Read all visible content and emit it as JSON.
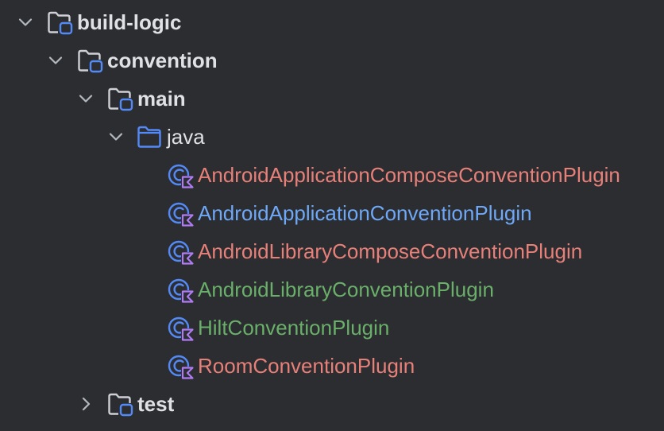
{
  "tree": {
    "build_logic": {
      "label": "build-logic",
      "expanded": true,
      "icon": "module-folder-icon"
    },
    "convention": {
      "label": "convention",
      "expanded": true,
      "icon": "module-folder-icon"
    },
    "main": {
      "label": "main",
      "expanded": true,
      "icon": "module-folder-icon"
    },
    "java": {
      "label": "java",
      "expanded": true,
      "icon": "source-folder-icon"
    },
    "files": [
      {
        "label": "AndroidApplicationComposeConventionPlugin",
        "color": "#e8807a",
        "icon": "kotlin-class-icon"
      },
      {
        "label": "AndroidApplicationConventionPlugin",
        "color": "#6fa8f7",
        "icon": "kotlin-class-icon"
      },
      {
        "label": "AndroidLibraryComposeConventionPlugin",
        "color": "#e8807a",
        "icon": "kotlin-class-icon"
      },
      {
        "label": "AndroidLibraryConventionPlugin",
        "color": "#6aaf6a",
        "icon": "kotlin-class-icon"
      },
      {
        "label": "HiltConventionPlugin",
        "color": "#6aaf6a",
        "icon": "kotlin-class-icon"
      },
      {
        "label": "RoomConventionPlugin",
        "color": "#e8807a",
        "icon": "kotlin-class-icon"
      }
    ],
    "test": {
      "label": "test",
      "expanded": false,
      "icon": "module-folder-icon"
    }
  },
  "colors": {
    "background": "#2b2d30",
    "folder_label": "#dfe1e5",
    "chevron": "#b4b8bf",
    "folder_outline": "#ced0d6",
    "folder_badge": "#548af7",
    "source_folder": "#548af7",
    "kotlin_badge": "#b07cf5"
  }
}
